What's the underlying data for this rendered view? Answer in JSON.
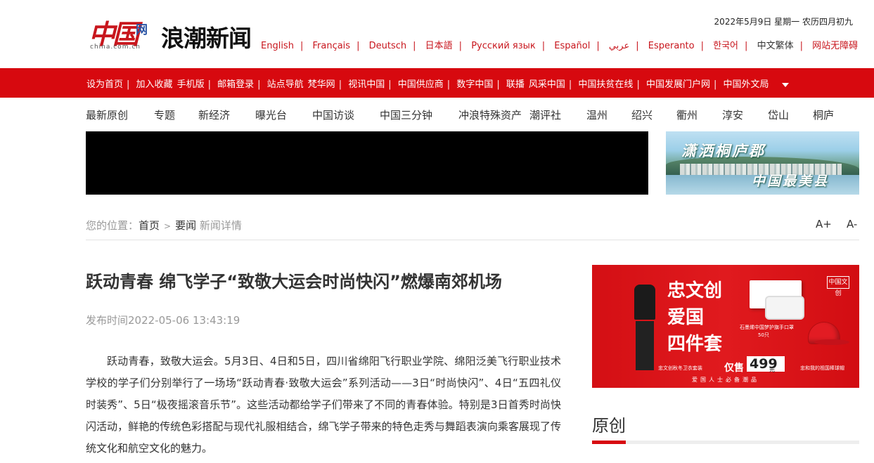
{
  "header": {
    "logo_text": "中国",
    "logo_wang": "网",
    "logo_url": "china.com.cn",
    "site_name": "浪潮新闻",
    "date": "2022年5月9日 星期一 农历四月初九",
    "languages": [
      "English",
      "Français",
      "Deutsch",
      "日本語",
      "Русский язык",
      "Español",
      "عربي",
      "Esperanto",
      "한국어",
      "中文繁体",
      "网站无障碍"
    ]
  },
  "red_nav": {
    "items": [
      "设为首页",
      "加入收藏",
      "手机版",
      "邮箱登录",
      "站点导航",
      "梵华网",
      "视讯中国",
      "中国供应商",
      "数字中国",
      "联播",
      "风采中国",
      "中国扶贫在线",
      "中国发展门户网",
      "中国外文局"
    ]
  },
  "sub_nav": {
    "items": [
      "最新原创",
      "专题",
      "新经济",
      "曝光台",
      "中国访谈",
      "中国三分钟",
      "冲浪特殊资产",
      "潮评社",
      "温州",
      "绍兴",
      "衢州",
      "淳安",
      "岱山",
      "桐庐"
    ]
  },
  "banner": {
    "text1": "潇洒桐庐郡",
    "text2": "中国最美县"
  },
  "breadcrumb": {
    "prefix": "您的位置：",
    "home": "首页",
    "sep": ">",
    "section": "要闻",
    "current": "新闻详情"
  },
  "font_controls": {
    "increase": "A+",
    "decrease": "A-"
  },
  "article": {
    "title": "跃动青春 绵飞学子“致敬大运会时尚快闪”燃爆南郊机场",
    "publish_time": "发布时间2022-05-06 13:43:19",
    "body": "跃动青春，致敬大运会。5月3日、4日和5日，四川省绵阳飞行职业学院、绵阳泛美飞行职业技术学校的学子们分别举行了一场场“跃动青春·致敬大运会”系列活动——3日“时尚快闪”、4日“五四礼仪时装秀”、5日“极夜摇滚音乐节”。这些活动都给学子们带来了不同的青春体验。特别是3日首秀时尚快闪活动，鲜艳的传统色彩搭配与现代礼服相结合，绵飞学子带来的特色走秀与舞蹈表演向乘客展现了传统文化和航空文化的魅力。"
  },
  "ad": {
    "title_lines": [
      "忠文创",
      "爱国",
      "四件套"
    ],
    "logo": "中国文创",
    "mask_caption": "石墨烯中国梦护旗手口罩",
    "mask_count": "50只",
    "jacket_caption": "忠文创秋冬卫衣套装",
    "cap_caption": "忠和我的祖国棒球帽",
    "price_label": "仅售",
    "price": "499",
    "price_unit": "元",
    "footer": "爱国人士必备潮品"
  },
  "section": {
    "title": "原创"
  }
}
